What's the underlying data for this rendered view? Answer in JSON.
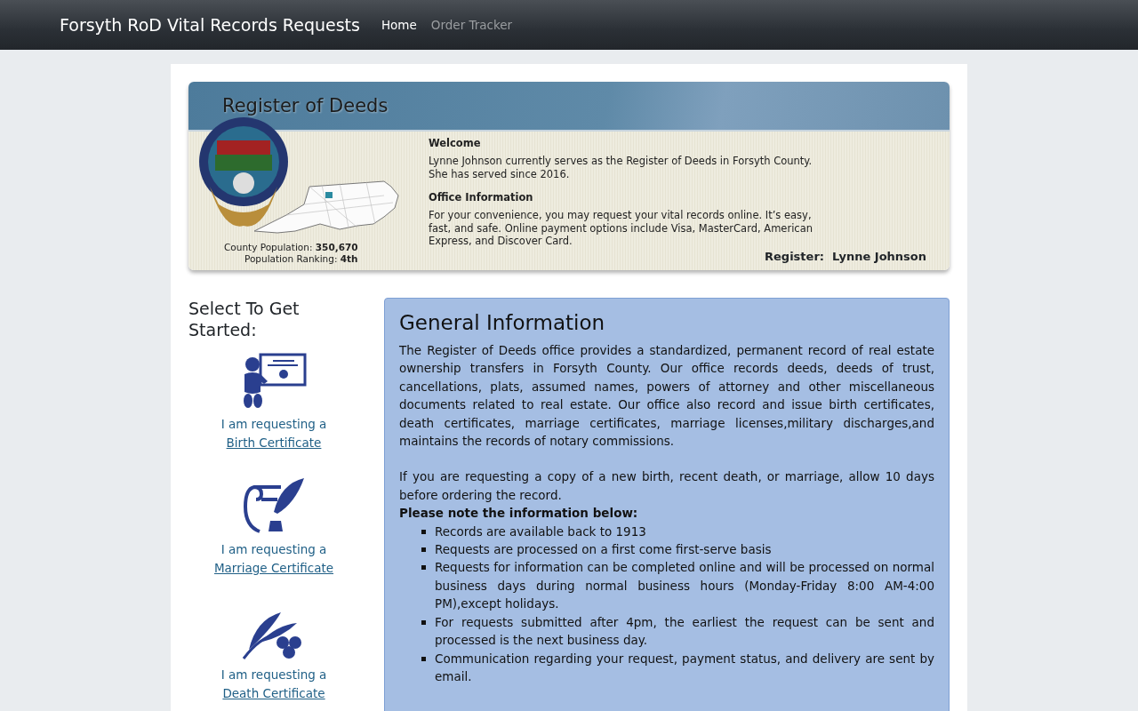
{
  "navbar": {
    "brand": "Forsyth RoD Vital Records Requests",
    "links": [
      {
        "label": "Home",
        "selected": true
      },
      {
        "label": "Order Tracker",
        "selected": false
      }
    ]
  },
  "banner": {
    "title": "Register of Deeds",
    "population_label": "County Population:",
    "population": "350,670",
    "ranking_label": "Population Ranking:",
    "ranking": "4th",
    "sections": [
      {
        "heading": "Welcome",
        "text": "Lynne Johnson currently serves as the Register of Deeds in Forsyth County. She has served since 2016."
      },
      {
        "heading": "Office Information",
        "text": "For your convenience, you may request your vital records online.  It’s easy, fast, and safe.  Online payment options include Visa, MasterCard, American Express, and Discover Card."
      }
    ],
    "register_label": "Register:",
    "register_name": "Lynne Johnson"
  },
  "get_started": {
    "heading": "Select To Get Started:",
    "options": [
      {
        "kind": "birth",
        "text": "I am requesting a",
        "link": "Birth Certificate"
      },
      {
        "kind": "marriage",
        "text": "I am requesting a",
        "link": "Marriage Certificate"
      },
      {
        "kind": "death",
        "text": "I am requesting a",
        "link": "Death Certificate"
      }
    ]
  },
  "general_info": {
    "heading": "General Information",
    "paragraphs": [
      "The Register of Deeds office  provides a standardized, permanent record of real estate ownership transfers in Forsyth County. Our office records deeds, deeds of trust, cancellations, plats, assumed names, powers of attorney and other miscellaneous documents related to real estate. Our office also record and issue birth certificates, death certificates, marriage certificates, marriage licenses,military discharges,and maintains the records of notary commissions.",
      "If you are requesting a copy of a new birth, recent death, or marriage, allow 10 days before ordering the record."
    ],
    "note_heading": "Please note the information below:",
    "bullets": [
      "Records are available back to 1913",
      "Requests are processed on a first come first-serve basis",
      "Requests for information can be completed online and will be processed on normal business days during normal business hours (Monday-Friday 8:00 AM-4:00 PM),except holidays.",
      "For requests submitted after 4pm, the earliest the request can be sent and processed is the next business day.",
      "Communication regarding your request, payment status, and delivery are sent by email."
    ]
  }
}
